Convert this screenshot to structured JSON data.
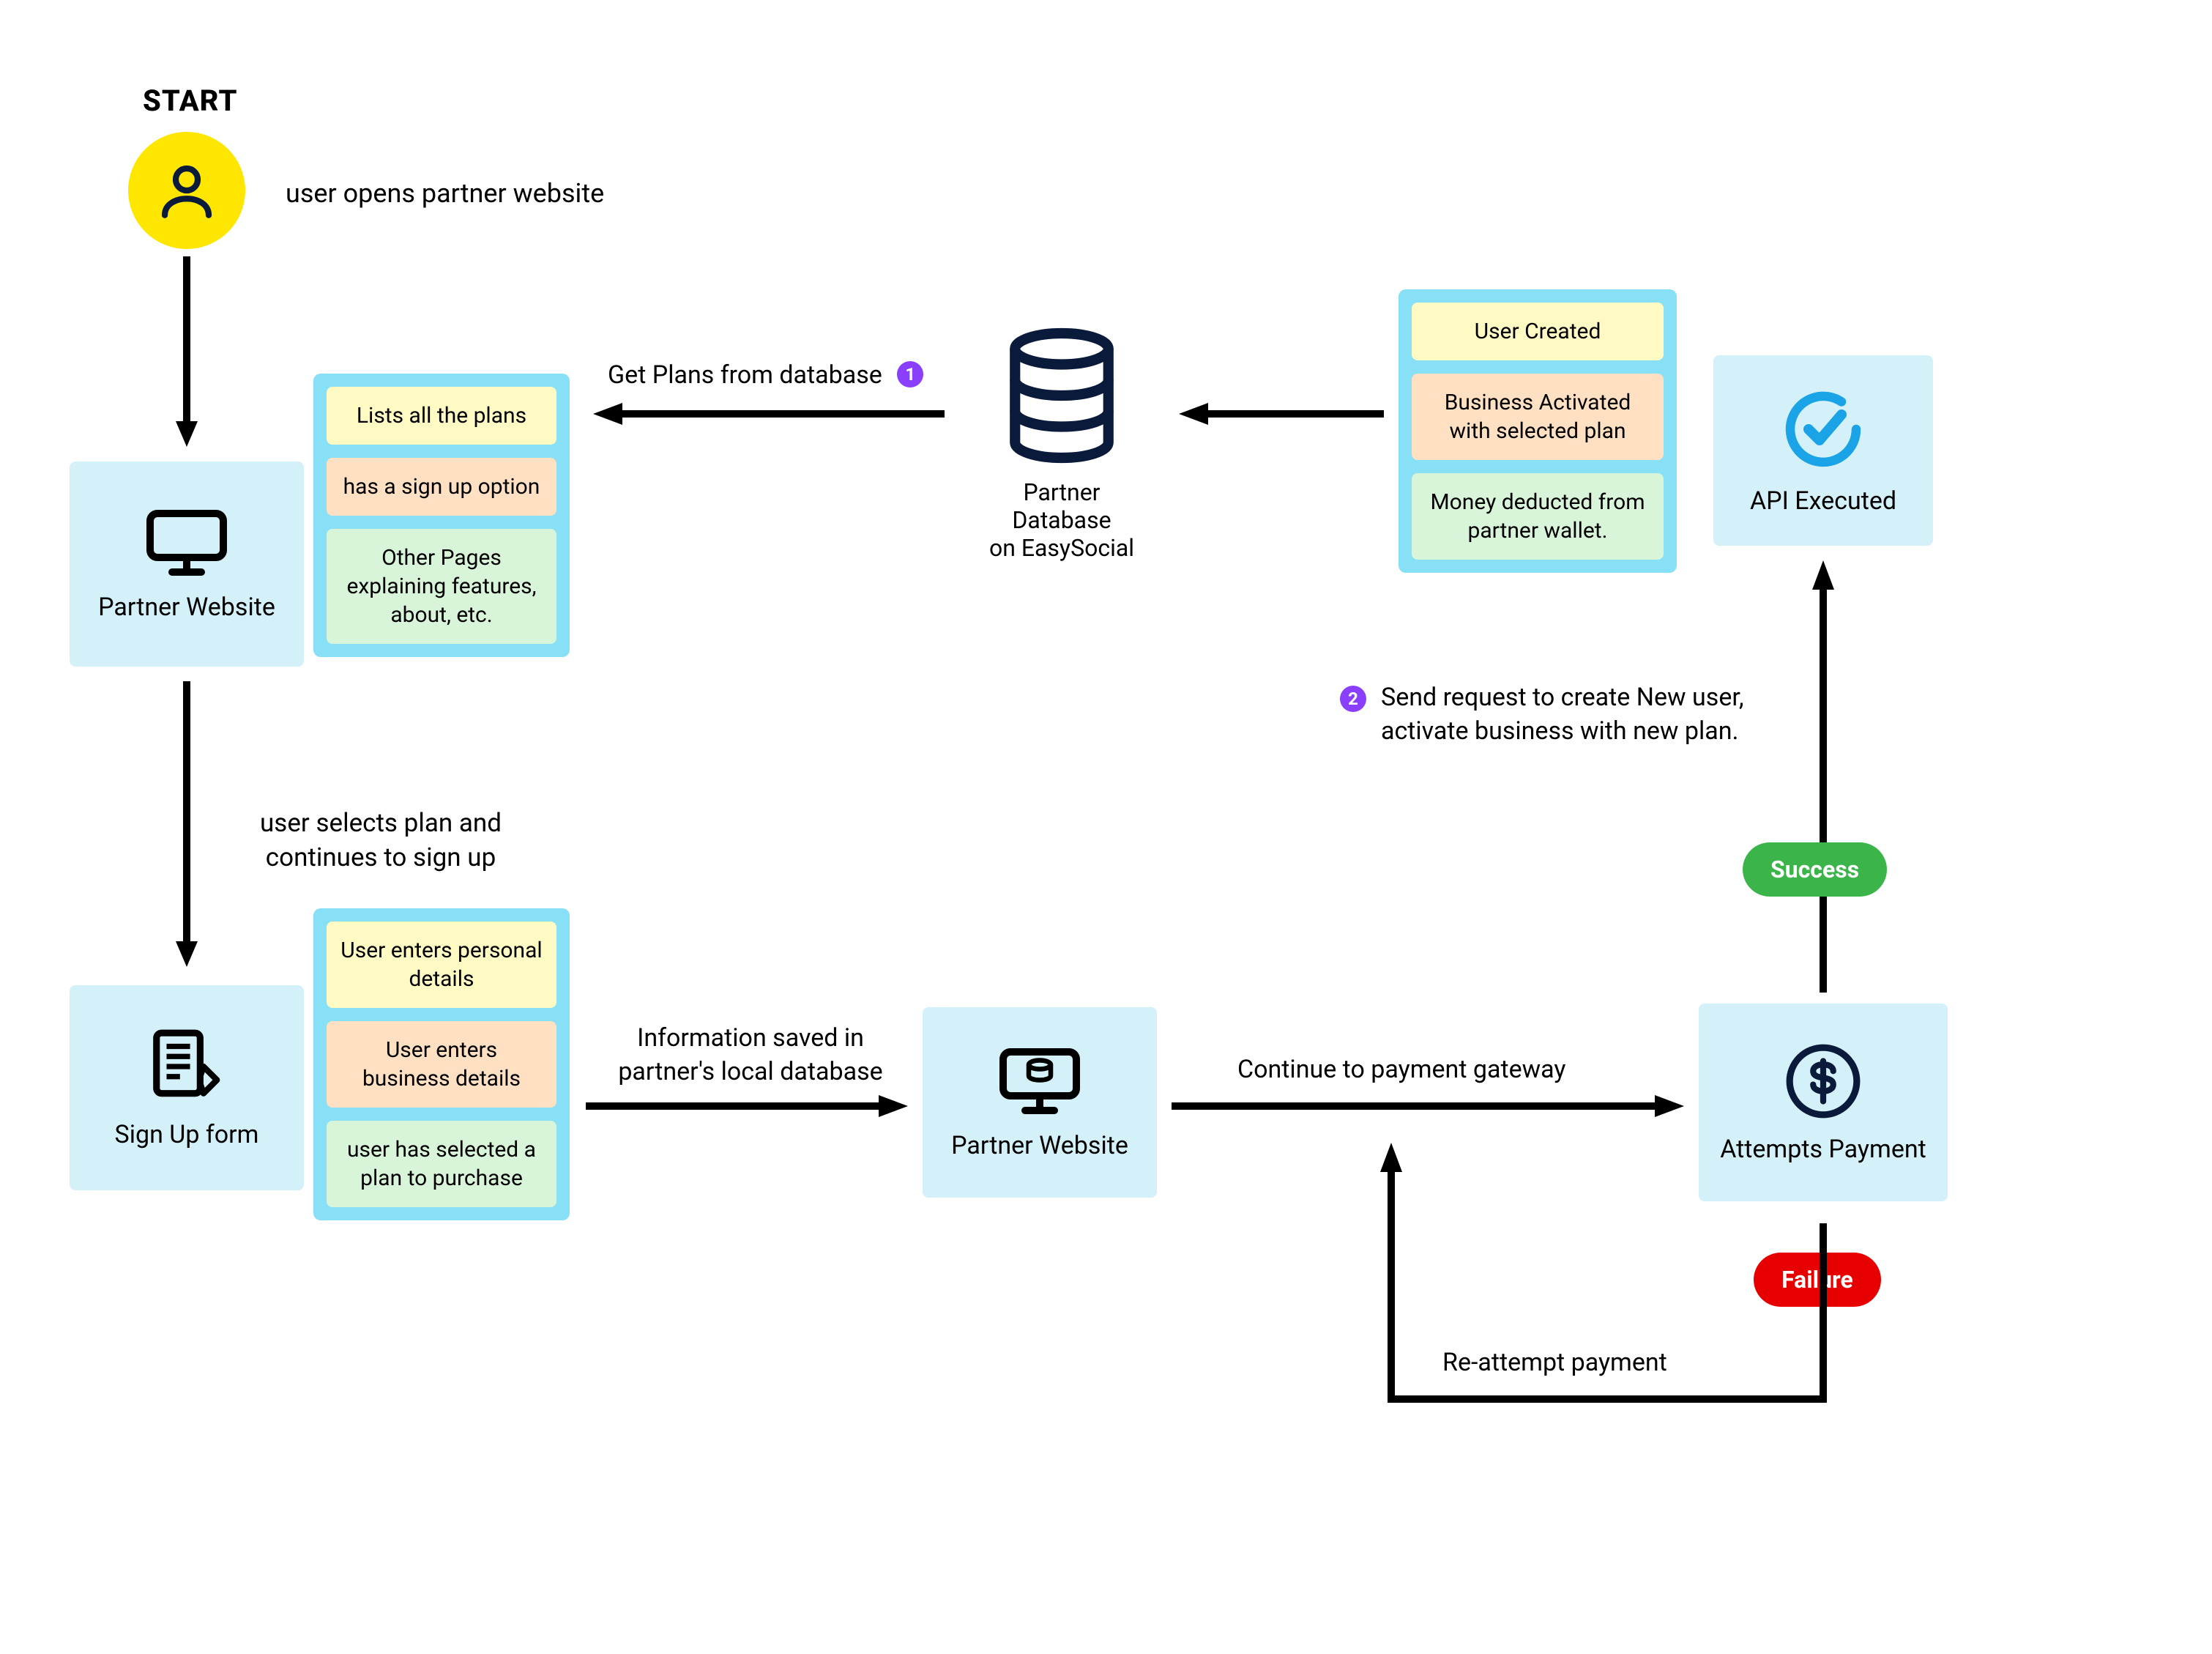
{
  "start_label": "START",
  "start_action": "user opens partner website",
  "nodes": {
    "partner_website": "Partner Website",
    "signup_form": "Sign Up form",
    "partner_db": "Partner Database\non EasySocial",
    "partner_website_2": "Partner Website",
    "attempts_payment": "Attempts Payment",
    "api_executed": "API Executed"
  },
  "lists": {
    "plans_box": [
      {
        "text": "Lists all the plans",
        "cls": "li-yellow"
      },
      {
        "text": "has a sign up option",
        "cls": "li-orange"
      },
      {
        "text": "Other Pages explaining features, about, etc.",
        "cls": "li-green"
      }
    ],
    "signup_box": [
      {
        "text": "User enters personal details",
        "cls": "li-yellow"
      },
      {
        "text": "User enters business details",
        "cls": "li-orange"
      },
      {
        "text": "user has selected a plan to purchase",
        "cls": "li-green"
      }
    ],
    "result_box": [
      {
        "text": "User Created",
        "cls": "li-yellow"
      },
      {
        "text": "Business Activated with selected plan",
        "cls": "li-orange"
      },
      {
        "text": "Money deducted from partner wallet.",
        "cls": "li-green"
      }
    ]
  },
  "edge_labels": {
    "get_plans": "Get Plans from database",
    "select_plan": "user selects plan and\ncontinues to sign up",
    "saved": "Information saved in\npartner's local database",
    "continue_pay": "Continue to payment gateway",
    "send_request": "Send request to create New user,\nactivate business with new plan.",
    "reattempt": "Re-attempt payment"
  },
  "badges": {
    "num1": "1",
    "num2": "2",
    "success": "Success",
    "failure": "Failure"
  }
}
